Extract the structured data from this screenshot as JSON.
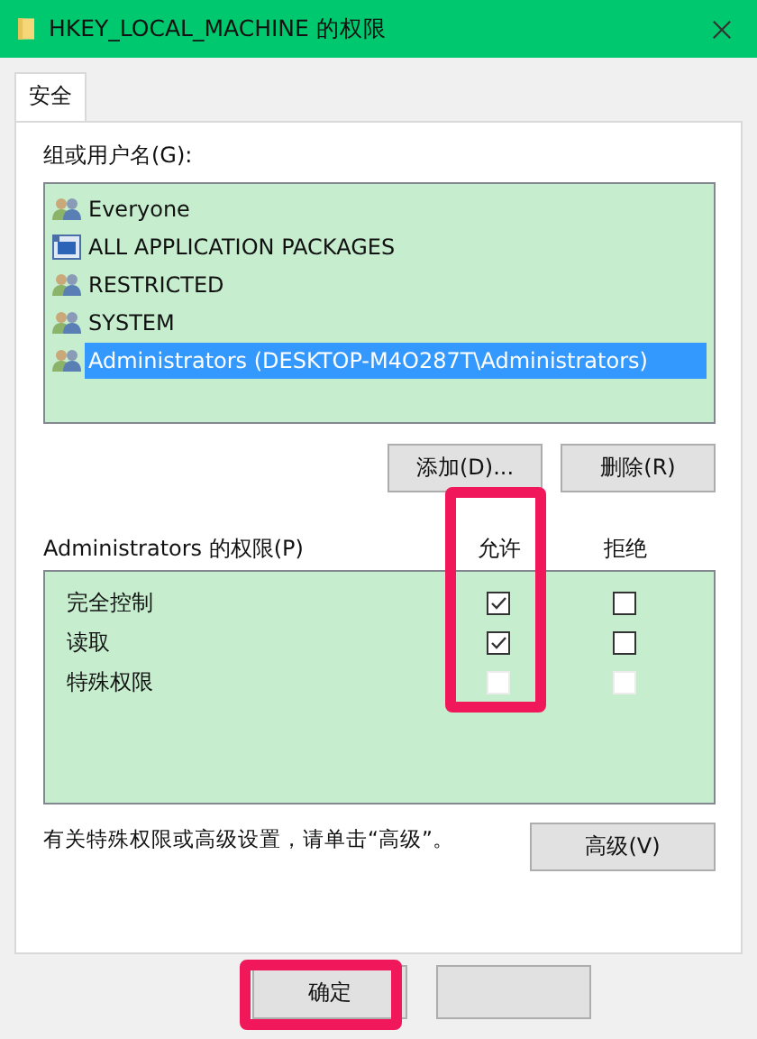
{
  "window": {
    "title": "HKEY_LOCAL_MACHINE 的权限"
  },
  "tabs": [
    {
      "label": "安全",
      "selected": true
    }
  ],
  "principals": {
    "label": "组或用户名(G):",
    "items": [
      {
        "name": "Everyone",
        "kind": "group",
        "selected": false
      },
      {
        "name": "ALL APPLICATION PACKAGES",
        "kind": "package",
        "selected": false
      },
      {
        "name": "RESTRICTED",
        "kind": "group",
        "selected": false
      },
      {
        "name": "SYSTEM",
        "kind": "group",
        "selected": false
      },
      {
        "name": "Administrators (DESKTOP-M4O287T\\Administrators)",
        "kind": "group",
        "selected": true
      }
    ],
    "buttons": [
      "添加(D)...",
      "删除(R)"
    ]
  },
  "permissions": {
    "label": "Administrators 的权限(P)",
    "columns": [
      "允许",
      "拒绝"
    ],
    "rows": [
      {
        "name": "完全控制",
        "allow": {
          "checked": true,
          "disabled": false
        },
        "deny": {
          "checked": false,
          "disabled": false
        }
      },
      {
        "name": "读取",
        "allow": {
          "checked": true,
          "disabled": false
        },
        "deny": {
          "checked": false,
          "disabled": false
        }
      },
      {
        "name": "特殊权限",
        "allow": {
          "checked": false,
          "disabled": true
        },
        "deny": {
          "checked": false,
          "disabled": true
        }
      }
    ]
  },
  "advanced": {
    "note": "有关特殊权限或高级设置，请单击“高级”。",
    "button": "高级(V)"
  },
  "footer_buttons": [
    "确定"
  ]
}
